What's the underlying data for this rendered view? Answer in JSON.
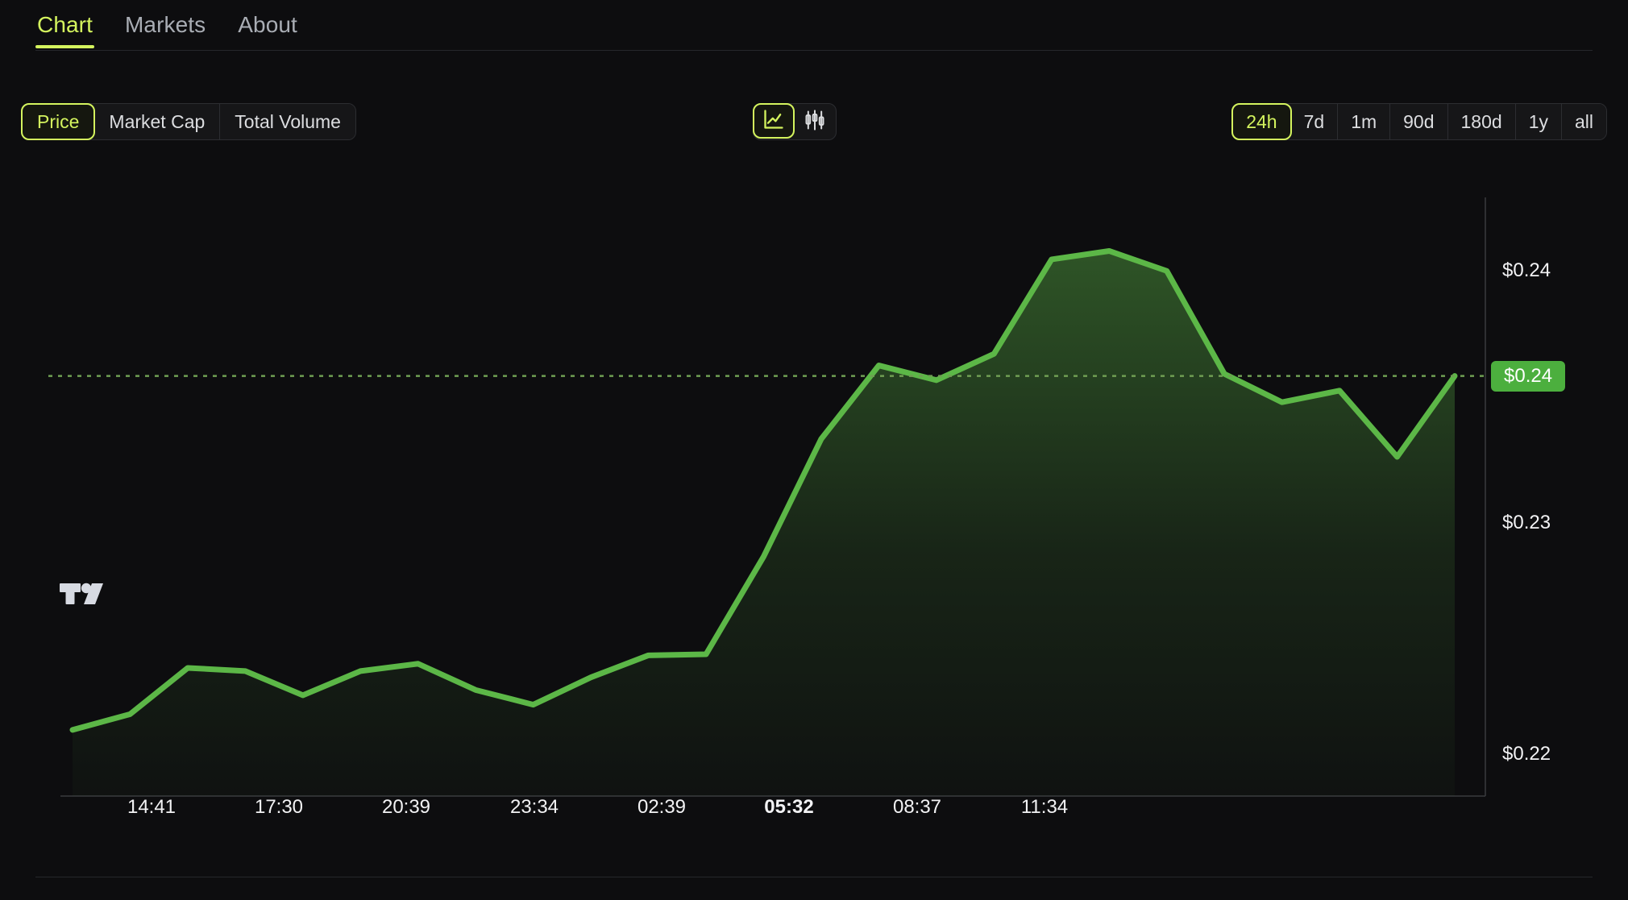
{
  "nav": {
    "tabs": [
      {
        "label": "Chart",
        "active": true
      },
      {
        "label": "Markets",
        "active": false
      },
      {
        "label": "About",
        "active": false
      }
    ]
  },
  "toolbar": {
    "metrics": [
      {
        "label": "Price",
        "active": true
      },
      {
        "label": "Market Cap",
        "active": false
      },
      {
        "label": "Total Volume",
        "active": false
      }
    ],
    "chart_types": [
      {
        "icon": "line-chart-icon",
        "active": true
      },
      {
        "icon": "candlestick-chart-icon",
        "active": false
      }
    ],
    "ranges": [
      {
        "label": "24h",
        "active": true
      },
      {
        "label": "7d",
        "active": false
      },
      {
        "label": "1m",
        "active": false
      },
      {
        "label": "90d",
        "active": false
      },
      {
        "label": "180d",
        "active": false
      },
      {
        "label": "1y",
        "active": false
      },
      {
        "label": "all",
        "active": false
      }
    ]
  },
  "colors": {
    "accent": "#d4f45e",
    "line": "#5cb747",
    "badge": "#4caf3e",
    "background": "#0d0d0f",
    "text": "#e8e8ea",
    "muted": "#a9adb4"
  },
  "chart_data": {
    "type": "area",
    "title": "",
    "xlabel": "",
    "ylabel": "",
    "grid": false,
    "legend": "none",
    "y_ticks": [
      "$0.24",
      "$0.24",
      "$0.23",
      "$0.22"
    ],
    "y_tick_values": [
      0.2445,
      0.2395,
      0.2325,
      0.2215
    ],
    "x_ticks": [
      "14:41",
      "17:30",
      "20:39",
      "23:34",
      "02:39",
      "05:32",
      "08:37",
      "11:34"
    ],
    "x_tick_bold": "05:32",
    "current_price_label": "$0.24",
    "reference_line_value": 0.2395,
    "ylim": [
      0.2195,
      0.248
    ],
    "series": [
      {
        "name": "Price",
        "points": [
          {
            "x": 0,
            "y": 0.22265
          },
          {
            "x": 1,
            "y": 0.2234
          },
          {
            "x": 2,
            "y": 0.2256
          },
          {
            "x": 3,
            "y": 0.22545
          },
          {
            "x": 4,
            "y": 0.2243
          },
          {
            "x": 5,
            "y": 0.22545
          },
          {
            "x": 6,
            "y": 0.2258
          },
          {
            "x": 7,
            "y": 0.22455
          },
          {
            "x": 8,
            "y": 0.22385
          },
          {
            "x": 9,
            "y": 0.22515
          },
          {
            "x": 10,
            "y": 0.2262
          },
          {
            "x": 11,
            "y": 0.22625
          },
          {
            "x": 12,
            "y": 0.2309
          },
          {
            "x": 13,
            "y": 0.2365
          },
          {
            "x": 14,
            "y": 0.24
          },
          {
            "x": 15,
            "y": 0.2393
          },
          {
            "x": 16,
            "y": 0.24055
          },
          {
            "x": 17,
            "y": 0.24505
          },
          {
            "x": 18,
            "y": 0.24545
          },
          {
            "x": 19,
            "y": 0.2445
          },
          {
            "x": 20,
            "y": 0.2396
          },
          {
            "x": 21,
            "y": 0.23825
          },
          {
            "x": 22,
            "y": 0.2388
          },
          {
            "x": 23,
            "y": 0.23565
          },
          {
            "x": 24,
            "y": 0.2395
          }
        ]
      }
    ]
  }
}
